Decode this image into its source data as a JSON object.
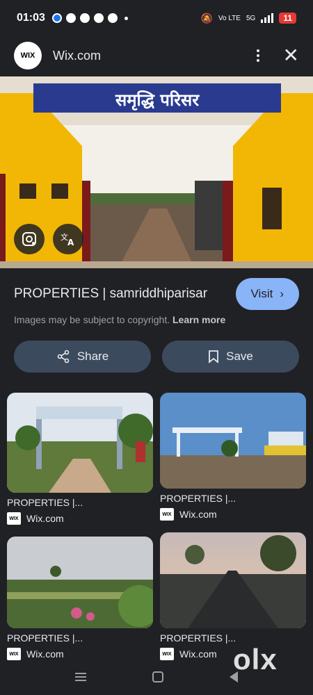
{
  "status_bar": {
    "time": "01:03",
    "network": "Vo LTE",
    "network_type": "5G",
    "battery": "11"
  },
  "header": {
    "logo_text": "WIX",
    "site": "Wix.com"
  },
  "hero": {
    "sign_text": "समृद्धि परिसर"
  },
  "result": {
    "title": "PROPERTIES | samriddhiparisar",
    "visit_label": "Visit",
    "copyright_text": "Images may be subject to copyright.",
    "learn_more": "Learn more"
  },
  "actions": {
    "share_label": "Share",
    "save_label": "Save"
  },
  "related": [
    {
      "title": "PROPERTIES |...",
      "source": "Wix.com",
      "favicon": "WIX"
    },
    {
      "title": "PROPERTIES |...",
      "source": "Wix.com",
      "favicon": "WIX"
    },
    {
      "title": "PROPERTIES |...",
      "source": "Wix.com",
      "favicon": "WIX"
    },
    {
      "title": "PROPERTIES |...",
      "source": "Wix.com",
      "favicon": "WIX"
    }
  ],
  "watermark": "olx",
  "colors": {
    "background": "#202124",
    "accent": "#8ab4f8",
    "button": "#3c4a5e",
    "gate_yellow": "#f2b705",
    "sign_blue": "#2a3b8f"
  }
}
